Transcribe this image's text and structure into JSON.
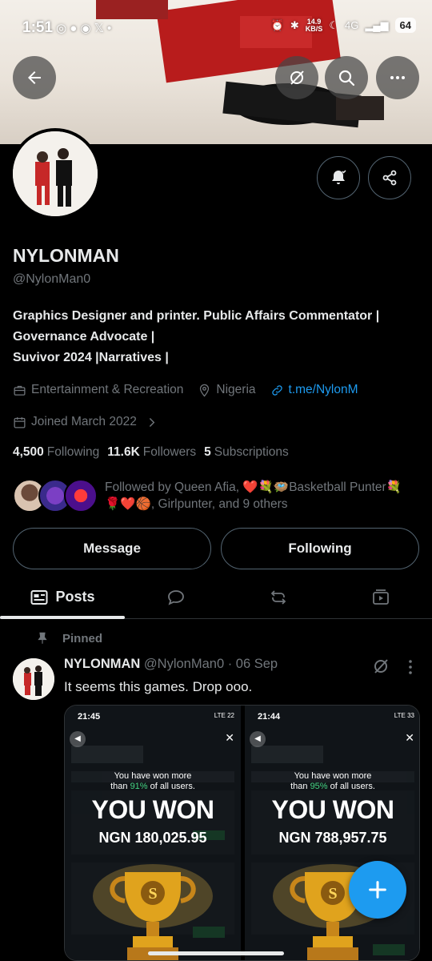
{
  "status_bar": {
    "time": "1:51",
    "left_icons": "◎ ● ◉ 𝕏 •",
    "net_speed_value": "14.9",
    "net_speed_unit": "KB/S",
    "network": "4G",
    "battery": "64"
  },
  "profile": {
    "name": "NYLONMAN",
    "handle": "@NylonMan0",
    "bio_lines": [
      "Graphics Designer and printer. Public Affairs Commentator |",
      "Governance Advocate |",
      "Suvivor 2024 |Narratives |"
    ],
    "category": "Entertainment & Recreation",
    "location": "Nigeria",
    "link": "t.me/NylonM",
    "joined": "Joined March 2022",
    "following_count": "4,500",
    "following_label": "Following",
    "followers_count": "11.6K",
    "followers_label": "Followers",
    "subscriptions_count": "5",
    "subscriptions_label": "Subscriptions",
    "followed_by_line1": "Followed by Queen Afia, ❤️💐🪺Basketball Punter💐",
    "followed_by_line2": "🌹❤️🏀, Girlpunter, and 9 others"
  },
  "actions": {
    "message": "Message",
    "following": "Following"
  },
  "tabs": {
    "posts": "Posts"
  },
  "post": {
    "pinned_label": "Pinned",
    "author": "NYLONMAN",
    "handle_date": "@NylonMan0 · 06 Sep",
    "text": "It seems this games. Drop ooo.",
    "media": [
      {
        "time": "21:45",
        "status": "LTE 22",
        "won_line1": "You have won more",
        "won_pre": "than ",
        "won_pct": "91%",
        "won_post": " of all users.",
        "headline": "YOU WON",
        "amount": "NGN 180,025.95"
      },
      {
        "time": "21:44",
        "status": "LTE 33",
        "won_line1": "You have won more",
        "won_pre": "than ",
        "won_pct": "95%",
        "won_post": " of all users.",
        "headline": "YOU WON",
        "amount": "NGN 788,957.75"
      }
    ]
  },
  "colors": {
    "accent": "#1d9bf0",
    "background": "#000000",
    "text_primary": "#e7e9ea",
    "text_secondary": "#71767b",
    "border": "#2f3336"
  }
}
